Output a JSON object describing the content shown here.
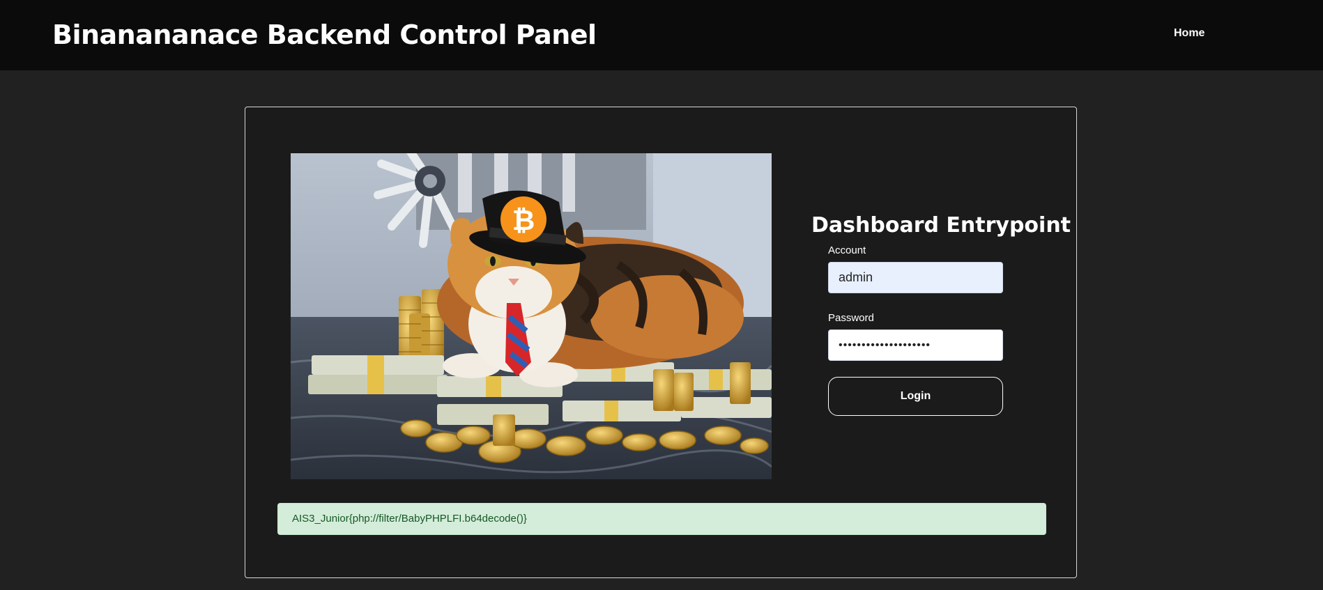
{
  "header": {
    "brand": "Binanananace Backend Control Panel",
    "nav_home": "Home"
  },
  "hero_image": {
    "description_icon": "cat-with-bitcoin-hat-icon"
  },
  "login_form": {
    "title": "Dashboard Entrypoint",
    "account_label": "Account",
    "account_value": "admin",
    "password_label": "Password",
    "password_value": "••••••••••••••••••••",
    "login_label": "Login"
  },
  "alert": {
    "message": "AIS3_Junior{php://filter/BabyPHPLFI.b64decode()}"
  },
  "colors": {
    "page_bg": "#212121",
    "navbar_bg": "#0b0b0b",
    "card_bg": "#1b1b1b",
    "alert_bg": "#d4edda",
    "alert_text": "#155724",
    "bitcoin_orange": "#f7931a"
  }
}
